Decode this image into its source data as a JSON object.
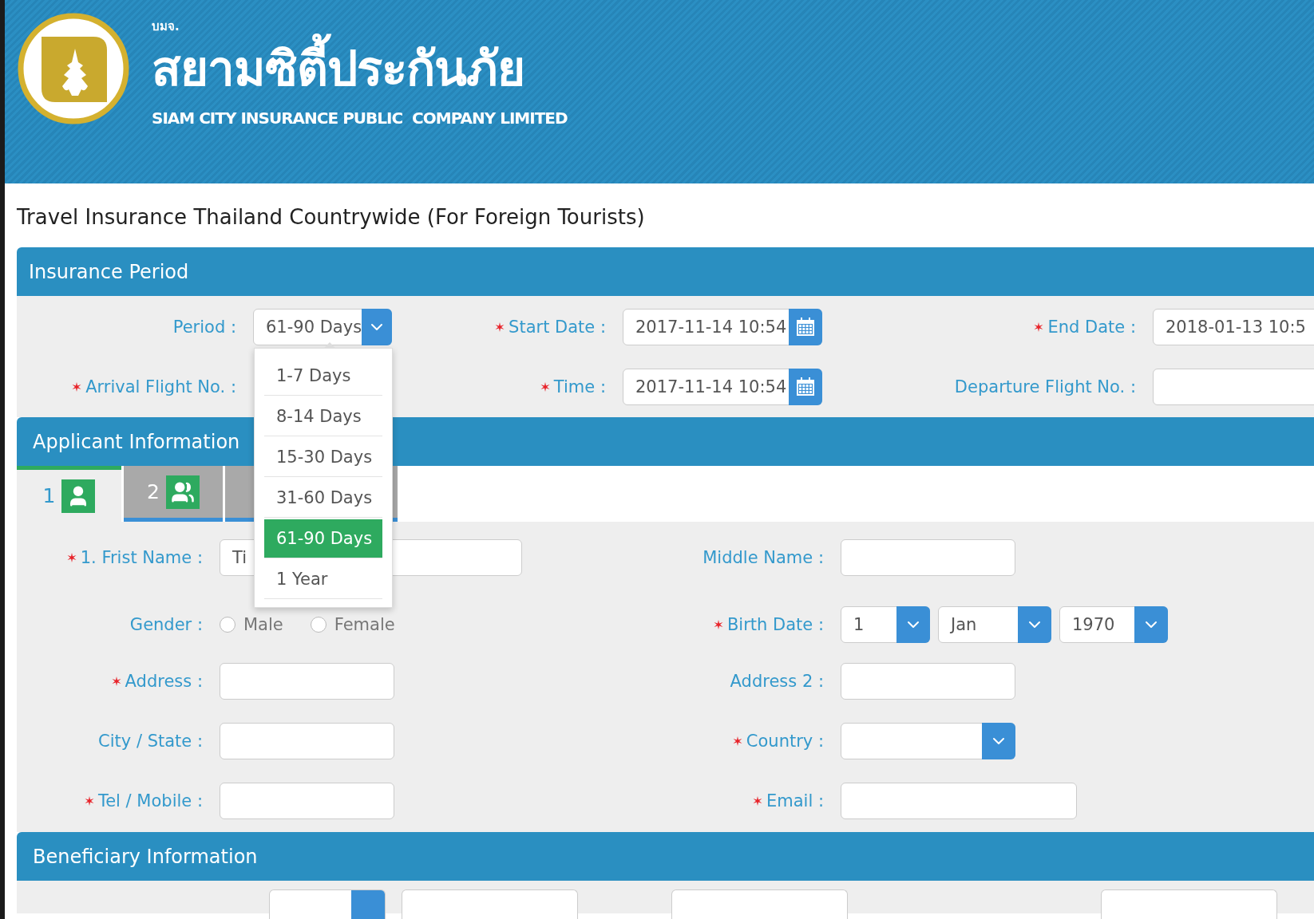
{
  "header": {
    "small_text": "บมจ.",
    "thai_name": "สยามซิตี้ประกันภัย",
    "english_name": "SIAM CITY INSURANCE PUBLIC  COMPANY LIMITED"
  },
  "page_title": "Travel Insurance Thailand Countrywide (For Foreign Tourists)",
  "insurance_period": {
    "heading": "Insurance Period",
    "rows": [
      [
        {
          "label": "Period :",
          "required": false,
          "kind": "select",
          "value": "61-90 Days",
          "open": true
        },
        {
          "label": "Start Date :",
          "required": true,
          "kind": "date",
          "value": "2017-11-14 10:54"
        },
        {
          "label": "End Date :",
          "required": true,
          "kind": "text",
          "value": "2018-01-13 10:5"
        }
      ],
      [
        {
          "label": "Arrival Flight No. :",
          "required": true,
          "kind": "hidden"
        },
        {
          "label": "Time :",
          "required": true,
          "kind": "date",
          "value": "2017-11-14 10:54"
        },
        {
          "label": "Departure Flight No. :",
          "required": false,
          "kind": "text"
        }
      ]
    ]
  },
  "period_menu": {
    "options": [
      {
        "label": "1-7 Days",
        "selected": false
      },
      {
        "label": "8-14 Days",
        "selected": false
      },
      {
        "label": "15-30 Days",
        "selected": false
      },
      {
        "label": "31-60 Days",
        "selected": false
      },
      {
        "label": "61-90 Days",
        "selected": true
      },
      {
        "label": "1 Year",
        "selected": false
      }
    ]
  },
  "applicant": {
    "heading": "Applicant Information",
    "tabs": [
      {
        "label": "1",
        "selected": true
      },
      {
        "label": "2",
        "selected": false
      },
      {
        "selected": false
      }
    ],
    "rows": [
      [
        {
          "label": "1. Frist Name :",
          "required": true,
          "kind": "wide-text",
          "value": "Ti"
        },
        {
          "label": "Middle Name :",
          "required": false,
          "kind": "text"
        }
      ],
      [
        {
          "label": "Gender :",
          "required": false,
          "kind": "radio",
          "options": [
            {
              "label": "Male",
              "selected": false
            },
            {
              "label": "Female",
              "selected": false
            }
          ]
        },
        {
          "label": "Birth Date :",
          "required": true,
          "kind": "selects",
          "values": [
            "1",
            "Jan",
            "1970"
          ]
        }
      ],
      [
        {
          "label": "Address :",
          "required": true,
          "kind": "text"
        },
        {
          "label": "Address 2 :",
          "required": false,
          "kind": "text"
        }
      ],
      [
        {
          "label": "City / State :",
          "required": false,
          "kind": "text"
        },
        {
          "label": "Country :",
          "required": true,
          "kind": "select"
        }
      ],
      [
        {
          "label": "Tel / Mobile :",
          "required": true,
          "kind": "text"
        },
        {
          "label": "Email :",
          "required": true,
          "kind": "wide-text"
        }
      ]
    ]
  },
  "beneficiary": {
    "heading": "Beneficiary Information",
    "fields": [
      {
        "kind": "select"
      },
      {
        "kind": "text"
      },
      {
        "kind": "text"
      },
      {
        "kind": "text"
      }
    ]
  }
}
